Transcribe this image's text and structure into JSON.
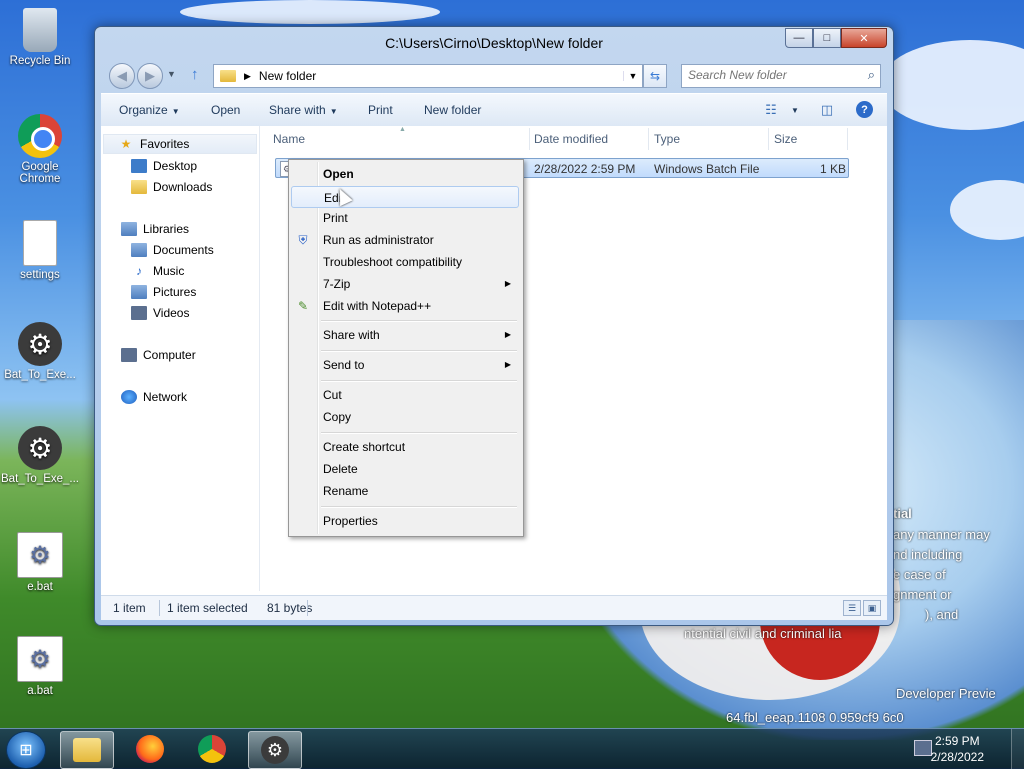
{
  "window": {
    "title": "C:\\Users\\Cirno\\Desktop\\New folder",
    "min_glyph": "—",
    "max_glyph": "□",
    "close_glyph": "✕"
  },
  "navbar": {
    "back_glyph": "◀",
    "forward_glyph": "▶",
    "dropdown_glyph": "▼",
    "up_glyph": "↑",
    "address": "New folder",
    "address_arrow": "▶",
    "address_dropdown": "▼",
    "refresh_glyph": "⇆",
    "search_placeholder": "Search New folder",
    "search_glyph": "⌕"
  },
  "toolbar": {
    "organize": "Organize",
    "open": "Open",
    "share_with": "Share with",
    "print": "Print",
    "new_folder": "New folder",
    "caret": "▼",
    "view_glyph": "☷",
    "pane_glyph": "◫",
    "help_glyph": "?"
  },
  "sidebar": {
    "favorites": "Favorites",
    "desktop": "Desktop",
    "downloads": "Downloads",
    "libraries": "Libraries",
    "documents": "Documents",
    "music": "Music",
    "pictures": "Pictures",
    "videos": "Videos",
    "computer": "Computer",
    "network": "Network",
    "star_glyph": "★",
    "music_glyph": "♪"
  },
  "columns": {
    "name": "Name",
    "date_modified": "Date modified",
    "type": "Type",
    "size": "Size"
  },
  "file": {
    "icon_glyph": "⚙",
    "date_modified": "2/28/2022 2:59 PM",
    "type": "Windows Batch File",
    "size": "1 KB"
  },
  "status": {
    "item_count": "1 item",
    "selection": "1 item selected",
    "selection_size": "81 bytes"
  },
  "context_menu": {
    "open": "Open",
    "edit": "Edit",
    "print": "Print",
    "run_as_admin": "Run as administrator",
    "troubleshoot": "Troubleshoot compatibility",
    "seven_zip": "7-Zip",
    "edit_notepadpp": "Edit with Notepad++",
    "share_with": "Share with",
    "send_to": "Send to",
    "cut": "Cut",
    "copy": "Copy",
    "create_shortcut": "Create shortcut",
    "delete": "Delete",
    "rename": "Rename",
    "properties": "Properties",
    "submenu_glyph": "▶",
    "shield_glyph": "⛨",
    "notepad_glyph": "✎"
  },
  "desktop_icons": {
    "recycle_bin": "Recycle Bin",
    "google_chrome": "Google Chrome",
    "settings": "settings",
    "bat_to_exe_1": "Bat_To_Exe...",
    "bat_to_exe_2": "Bat_To_Exe_...",
    "e_bat": "e.bat",
    "a_bat": "a.bat",
    "gear_glyph": "⚙"
  },
  "watermark": {
    "line1": "tial",
    "line2": "any manner may",
    "line3": "nd including",
    "line4": "e case of",
    "line5": "gnment or",
    "line6": "), and",
    "line7": "ntential civil and criminal lia",
    "line8": "Developer Previe",
    "line9": "64.fbl_eeap.1108 0.959cf9 6c0"
  },
  "taskbar": {
    "start_glyph": "⊞",
    "gear_glyph": "⚙",
    "time": "2:59 PM",
    "date": "2/28/2022"
  }
}
